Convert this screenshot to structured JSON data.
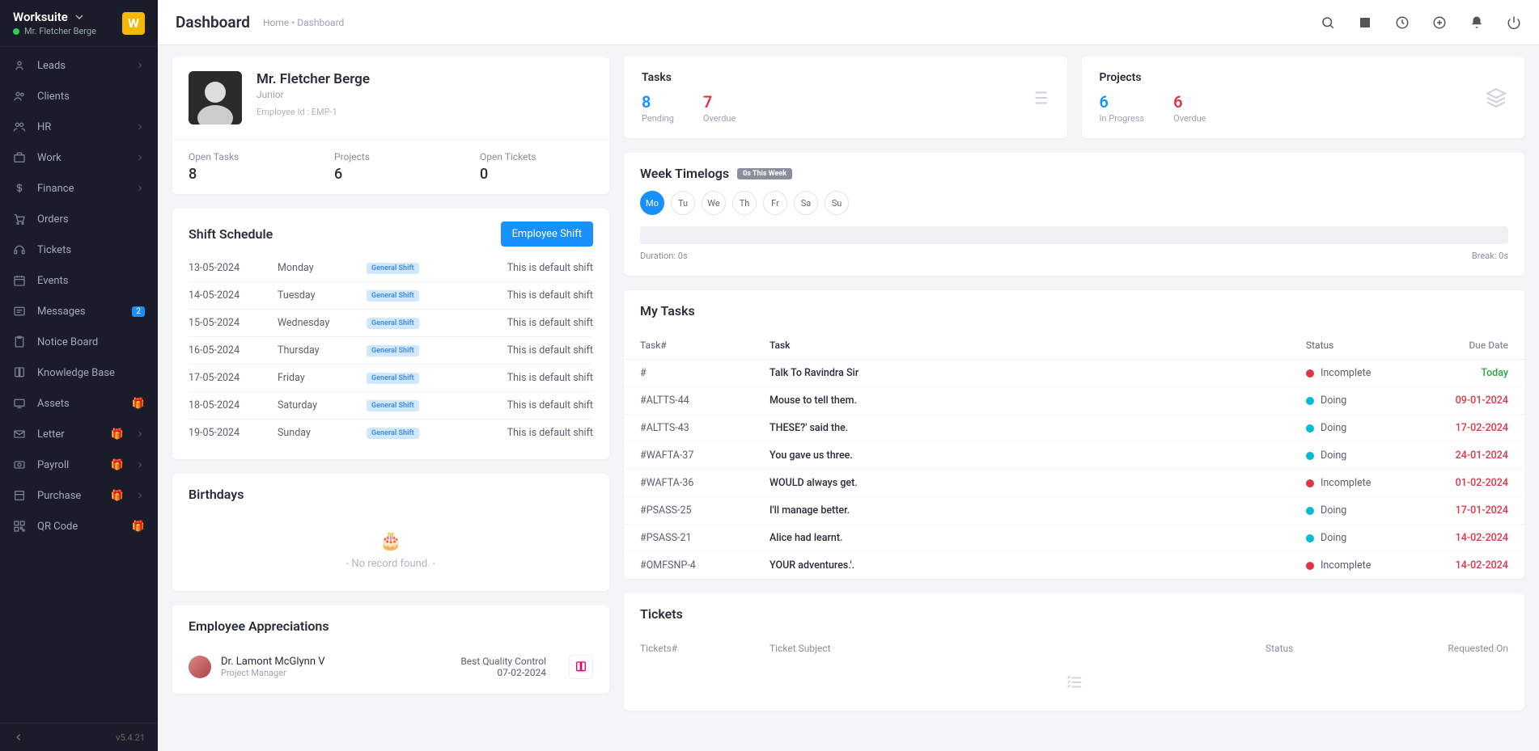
{
  "org": {
    "name": "Worksuite",
    "user": "Mr. Fletcher Berge",
    "logo": "W"
  },
  "topbar": {
    "title": "Dashboard",
    "crumb": "Home • Dashboard"
  },
  "sidebar": {
    "items": [
      {
        "label": "Leads",
        "icon": "nav-leads",
        "chevron": true
      },
      {
        "label": "Clients",
        "icon": "nav-clients"
      },
      {
        "label": "HR",
        "icon": "nav-hr",
        "chevron": true
      },
      {
        "label": "Work",
        "icon": "nav-work",
        "chevron": true
      },
      {
        "label": "Finance",
        "icon": "nav-finance",
        "chevron": true
      },
      {
        "label": "Orders",
        "icon": "nav-orders"
      },
      {
        "label": "Tickets",
        "icon": "nav-tickets"
      },
      {
        "label": "Events",
        "icon": "nav-events"
      },
      {
        "label": "Messages",
        "icon": "nav-messages",
        "badge": "2"
      },
      {
        "label": "Notice Board",
        "icon": "nav-notice"
      },
      {
        "label": "Knowledge Base",
        "icon": "nav-kb"
      },
      {
        "label": "Assets",
        "icon": "nav-assets",
        "gift": true
      },
      {
        "label": "Letter",
        "icon": "nav-letter",
        "gift": true,
        "chevron": true
      },
      {
        "label": "Payroll",
        "icon": "nav-payroll",
        "gift": true,
        "chevron": true
      },
      {
        "label": "Purchase",
        "icon": "nav-purchase",
        "gift": true,
        "chevron": true
      },
      {
        "label": "QR Code",
        "icon": "nav-qr",
        "gift": true
      }
    ],
    "version": "v5.4.21"
  },
  "profile": {
    "name": "Mr. Fletcher Berge",
    "role": "Junior",
    "emp_id": "Employee Id : EMP-1",
    "stats": [
      {
        "label": "Open Tasks",
        "value": "8"
      },
      {
        "label": "Projects",
        "value": "6"
      },
      {
        "label": "Open Tickets",
        "value": "0"
      }
    ]
  },
  "shift": {
    "title": "Shift Schedule",
    "btn": "Employee Shift",
    "badge": "General Shift",
    "rows": [
      {
        "date": "13-05-2024",
        "day": "Monday",
        "note": "This is default shift"
      },
      {
        "date": "14-05-2024",
        "day": "Tuesday",
        "note": "This is default shift"
      },
      {
        "date": "15-05-2024",
        "day": "Wednesday",
        "note": "This is default shift"
      },
      {
        "date": "16-05-2024",
        "day": "Thursday",
        "note": "This is default shift"
      },
      {
        "date": "17-05-2024",
        "day": "Friday",
        "note": "This is default shift"
      },
      {
        "date": "18-05-2024",
        "day": "Saturday",
        "note": "This is default shift"
      },
      {
        "date": "19-05-2024",
        "day": "Sunday",
        "note": "This is default shift"
      }
    ]
  },
  "birthdays": {
    "title": "Birthdays",
    "empty": "- No record found. -"
  },
  "appreciations": {
    "title": "Employee Appreciations",
    "name": "Dr. Lamont McGlynn V",
    "role": "Project Manager",
    "award": "Best Quality Control",
    "date": "07-02-2024"
  },
  "stat_cards": {
    "tasks": {
      "title": "Tasks",
      "a_val": "8",
      "a_lbl": "Pending",
      "b_val": "7",
      "b_lbl": "Overdue"
    },
    "projects": {
      "title": "Projects",
      "a_val": "6",
      "a_lbl": "In Progress",
      "b_val": "6",
      "b_lbl": "Overdue"
    }
  },
  "timelogs": {
    "title": "Week Timelogs",
    "badge": "0s This Week",
    "days": [
      "Mo",
      "Tu",
      "We",
      "Th",
      "Fr",
      "Sa",
      "Su"
    ],
    "active": 0,
    "duration": "Duration: 0s",
    "break": "Break: 0s"
  },
  "mytasks": {
    "title": "My Tasks",
    "headers": {
      "id": "Task#",
      "task": "Task",
      "status": "Status",
      "due": "Due Date"
    },
    "rows": [
      {
        "id": "#",
        "task": "Talk To Ravindra Sir",
        "status": "Incomplete",
        "dot": "red",
        "due": "Today",
        "due_color": "green"
      },
      {
        "id": "#ALTTS-44",
        "task": "Mouse to tell them.",
        "status": "Doing",
        "dot": "blue",
        "due": "09-01-2024",
        "due_color": "red"
      },
      {
        "id": "#ALTTS-43",
        "task": "THESE?' said the.",
        "status": "Doing",
        "dot": "blue",
        "due": "17-02-2024",
        "due_color": "red"
      },
      {
        "id": "#WAFTA-37",
        "task": "You gave us three.",
        "status": "Doing",
        "dot": "blue",
        "due": "24-01-2024",
        "due_color": "red"
      },
      {
        "id": "#WAFTA-36",
        "task": "WOULD always get.",
        "status": "Incomplete",
        "dot": "red",
        "due": "01-02-2024",
        "due_color": "red"
      },
      {
        "id": "#PSASS-25",
        "task": "I'll manage better.",
        "status": "Doing",
        "dot": "blue",
        "due": "17-01-2024",
        "due_color": "red"
      },
      {
        "id": "#PSASS-21",
        "task": "Alice had learnt.",
        "status": "Doing",
        "dot": "blue",
        "due": "14-02-2024",
        "due_color": "red"
      },
      {
        "id": "#OMFSNP-4",
        "task": "YOUR adventures.'.",
        "status": "Incomplete",
        "dot": "red",
        "due": "14-02-2024",
        "due_color": "red"
      }
    ]
  },
  "tickets": {
    "title": "Tickets",
    "headers": {
      "id": "Tickets#",
      "subject": "Ticket Subject",
      "status": "Status",
      "req": "Requested On"
    }
  }
}
